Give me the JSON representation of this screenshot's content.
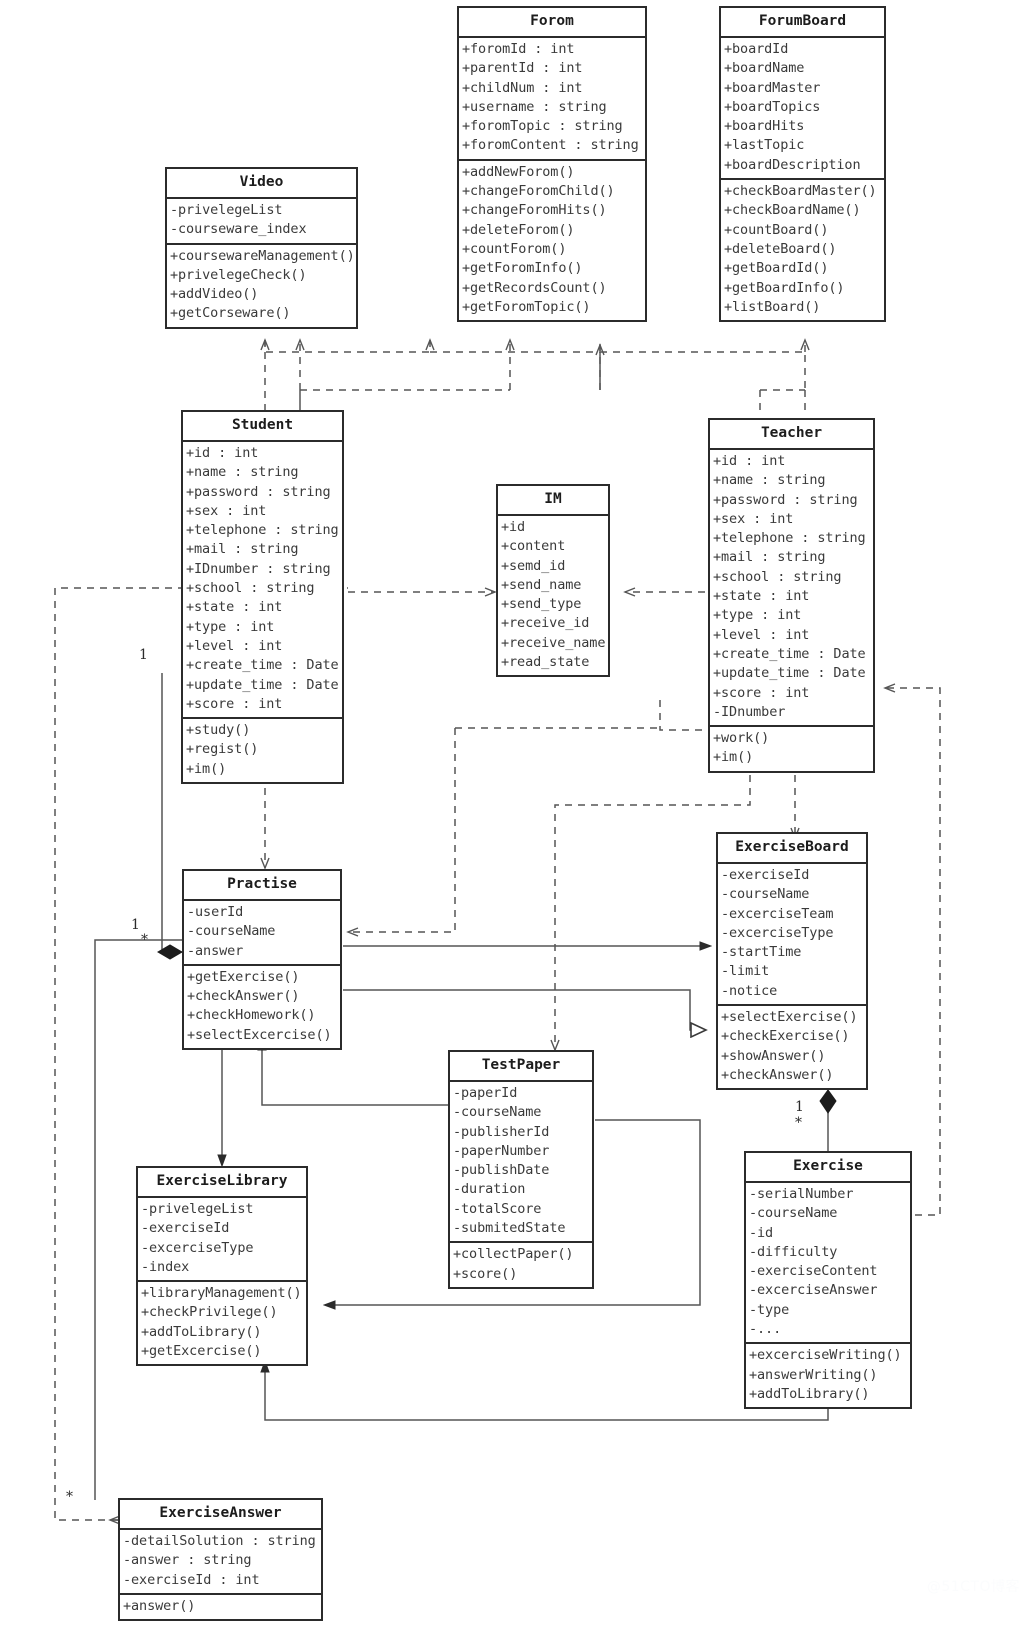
{
  "diagram": {
    "type": "uml-class-diagram",
    "watermark": "@51CTO博客",
    "classes": [
      {
        "id": "forom",
        "name": "Forom",
        "attributes": [
          "+foromId : int",
          "+parentId : int",
          "+childNum : int",
          "+username : string",
          "+foromTopic : string",
          "+foromContent : string"
        ],
        "methods": [
          "+addNewForom()",
          "+changeForomChild()",
          "+changeForomHits()",
          "+deleteForom()",
          "+countForom()",
          "+getForomInfo()",
          "+getRecordsCount()",
          "+getForomTopic()"
        ]
      },
      {
        "id": "forumboard",
        "name": "ForumBoard",
        "attributes": [
          "+boardId",
          "+boardName",
          "+boardMaster",
          "+boardTopics",
          "+boardHits",
          "+lastTopic",
          "+boardDescription"
        ],
        "methods": [
          "+checkBoardMaster()",
          "+checkBoardName()",
          "+countBoard()",
          "+deleteBoard()",
          "+getBoardId()",
          "+getBoardInfo()",
          "+listBoard()"
        ]
      },
      {
        "id": "video",
        "name": "Video",
        "attributes": [
          "-privelegeList",
          "-courseware_index"
        ],
        "methods": [
          "+coursewareManagement()",
          "+privelegeCheck()",
          "+addVideo()",
          "+getCorseware()"
        ]
      },
      {
        "id": "student",
        "name": "Student",
        "attributes": [
          "+id : int",
          "+name : string",
          "+password : string",
          "+sex : int",
          "+telephone : string",
          "+mail : string",
          "+IDnumber : string",
          "+school : string",
          "+state : int",
          "+type : int",
          "+level : int",
          "+create_time : Date",
          "+update_time : Date",
          "+score : int"
        ],
        "methods": [
          "+study()",
          "+regist()",
          "+im()"
        ]
      },
      {
        "id": "im",
        "name": "IM",
        "attributes": [
          "+id",
          "+content",
          "+semd_id",
          "+send_name",
          "+send_type",
          "+receive_id",
          "+receive_name",
          "+read_state"
        ],
        "methods": []
      },
      {
        "id": "teacher",
        "name": "Teacher",
        "attributes": [
          "+id : int",
          "+name : string",
          "+password : string",
          "+sex : int",
          "+telephone : string",
          "+mail : string",
          "+school : string",
          "+state : int",
          "+type : int",
          "+level : int",
          "+create_time : Date",
          "+update_time : Date",
          "+score : int",
          "-IDnumber"
        ],
        "methods": [
          "+work()",
          "+im()"
        ]
      },
      {
        "id": "practise",
        "name": "Practise",
        "attributes": [
          "-userId",
          "-courseName",
          "-answer"
        ],
        "methods": [
          "+getExercise()",
          "+checkAnswer()",
          "+checkHomework()",
          "+selectExcercise()"
        ]
      },
      {
        "id": "exerciseboard",
        "name": "ExerciseBoard",
        "attributes": [
          "-exerciseId",
          "-courseName",
          "-excerciseTeam",
          "-excerciseType",
          "-startTime",
          "-limit",
          "-notice"
        ],
        "methods": [
          "+selectExercise()",
          "+checkExercise()",
          "+showAnswer()",
          "+checkAnswer()"
        ]
      },
      {
        "id": "testpaper",
        "name": "TestPaper",
        "attributes": [
          "-paperId",
          "-courseName",
          "-publisherId",
          "-paperNumber",
          "-publishDate",
          "-duration",
          "-totalScore",
          "-submitedState"
        ],
        "methods": [
          "+collectPaper()",
          "+score()"
        ]
      },
      {
        "id": "exerciselibrary",
        "name": "ExerciseLibrary",
        "attributes": [
          "-privelegeList",
          "-exerciseId",
          "-excerciseType",
          "-index"
        ],
        "methods": [
          "+libraryManagement()",
          "+checkPrivilege()",
          "+addToLibrary()",
          "+getExcercise()"
        ]
      },
      {
        "id": "exercise",
        "name": "Exercise",
        "attributes": [
          "-serialNumber",
          "-courseName",
          "-id",
          "-difficulty",
          "-exerciseContent",
          "-excerciseAnswer",
          "-type",
          "-..."
        ],
        "methods": [
          "+excerciseWriting()",
          "+answerWriting()",
          "+addToLibrary()"
        ]
      },
      {
        "id": "exerciseanswer",
        "name": "ExerciseAnswer",
        "attributes": [
          "-detailSolution : string",
          "-answer : string",
          "-exerciseId : int"
        ],
        "methods": [
          "+answer()"
        ]
      }
    ],
    "multiplicities": [
      {
        "id": "m1",
        "text": "1"
      },
      {
        "id": "m2",
        "text": "1"
      },
      {
        "id": "m3",
        "text": "*"
      },
      {
        "id": "m4",
        "text": "1"
      },
      {
        "id": "m5",
        "text": "*"
      },
      {
        "id": "m6",
        "text": "*"
      }
    ]
  }
}
